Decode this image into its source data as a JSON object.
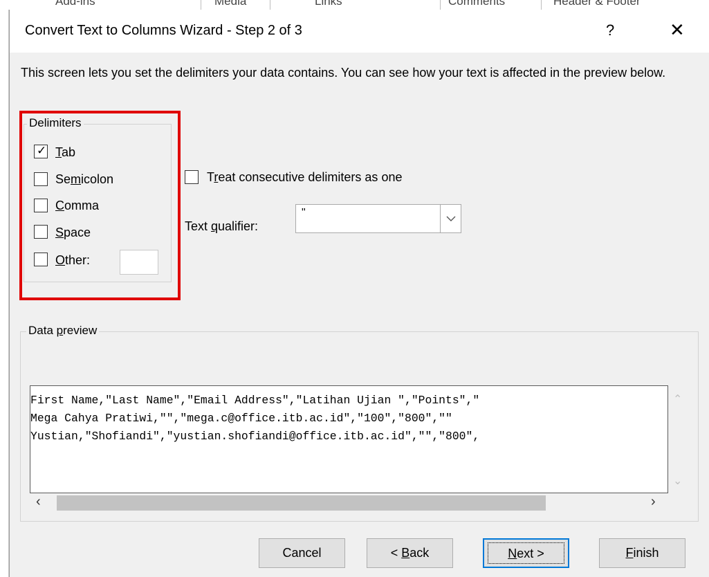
{
  "dialog": {
    "title": "Convert Text to Columns Wizard - Step 2 of 3",
    "help_glyph": "?",
    "close_glyph": "✕",
    "description": "This screen lets you set the delimiters your data contains.  You can see how your text is affected in the preview below."
  },
  "delimiters": {
    "legend": "Delimiters",
    "items": [
      {
        "pre": "",
        "accel": "T",
        "post": "ab",
        "checked": true
      },
      {
        "pre": "Se",
        "accel": "m",
        "post": "icolon",
        "checked": false
      },
      {
        "pre": "",
        "accel": "C",
        "post": "omma",
        "checked": false
      },
      {
        "pre": "",
        "accel": "S",
        "post": "pace",
        "checked": false
      },
      {
        "pre": "",
        "accel": "O",
        "post": "ther:",
        "checked": false
      }
    ],
    "other_value": ""
  },
  "consecutive": {
    "pre": "T",
    "accel": "r",
    "post": "eat consecutive delimiters as one",
    "checked": false
  },
  "qualifier": {
    "label_pre": "Text ",
    "label_accel": "q",
    "label_post": "ualifier:",
    "value": "\""
  },
  "preview": {
    "legend_pre": "Data ",
    "legend_accel": "p",
    "legend_post": "review",
    "lines": [
      "First Name,\"Last Name\",\"Email Address\",\"Latihan Ujian \",\"Points\",\"",
      "Mega Cahya Pratiwi,\"\",\"mega.c@office.itb.ac.id\",\"100\",\"800\",\"\"",
      "Yustian,\"Shofiandi\",\"yustian.shofiandi@office.itb.ac.id\",\"\",\"800\","
    ]
  },
  "buttons": {
    "cancel": "Cancel",
    "back_pre": "< ",
    "back_accel": "B",
    "back_post": "ack",
    "next_accel": "N",
    "next_post": "ext >",
    "finish_accel": "F",
    "finish_post": "inish"
  },
  "background": {
    "headers": [
      "Add-ins",
      "Media",
      "Links",
      "Comments",
      "Header & Footer"
    ]
  },
  "colors": {
    "highlight": "#e00000",
    "default_button_border": "#0078d7",
    "dialog_bg": "#f0f0f0"
  }
}
